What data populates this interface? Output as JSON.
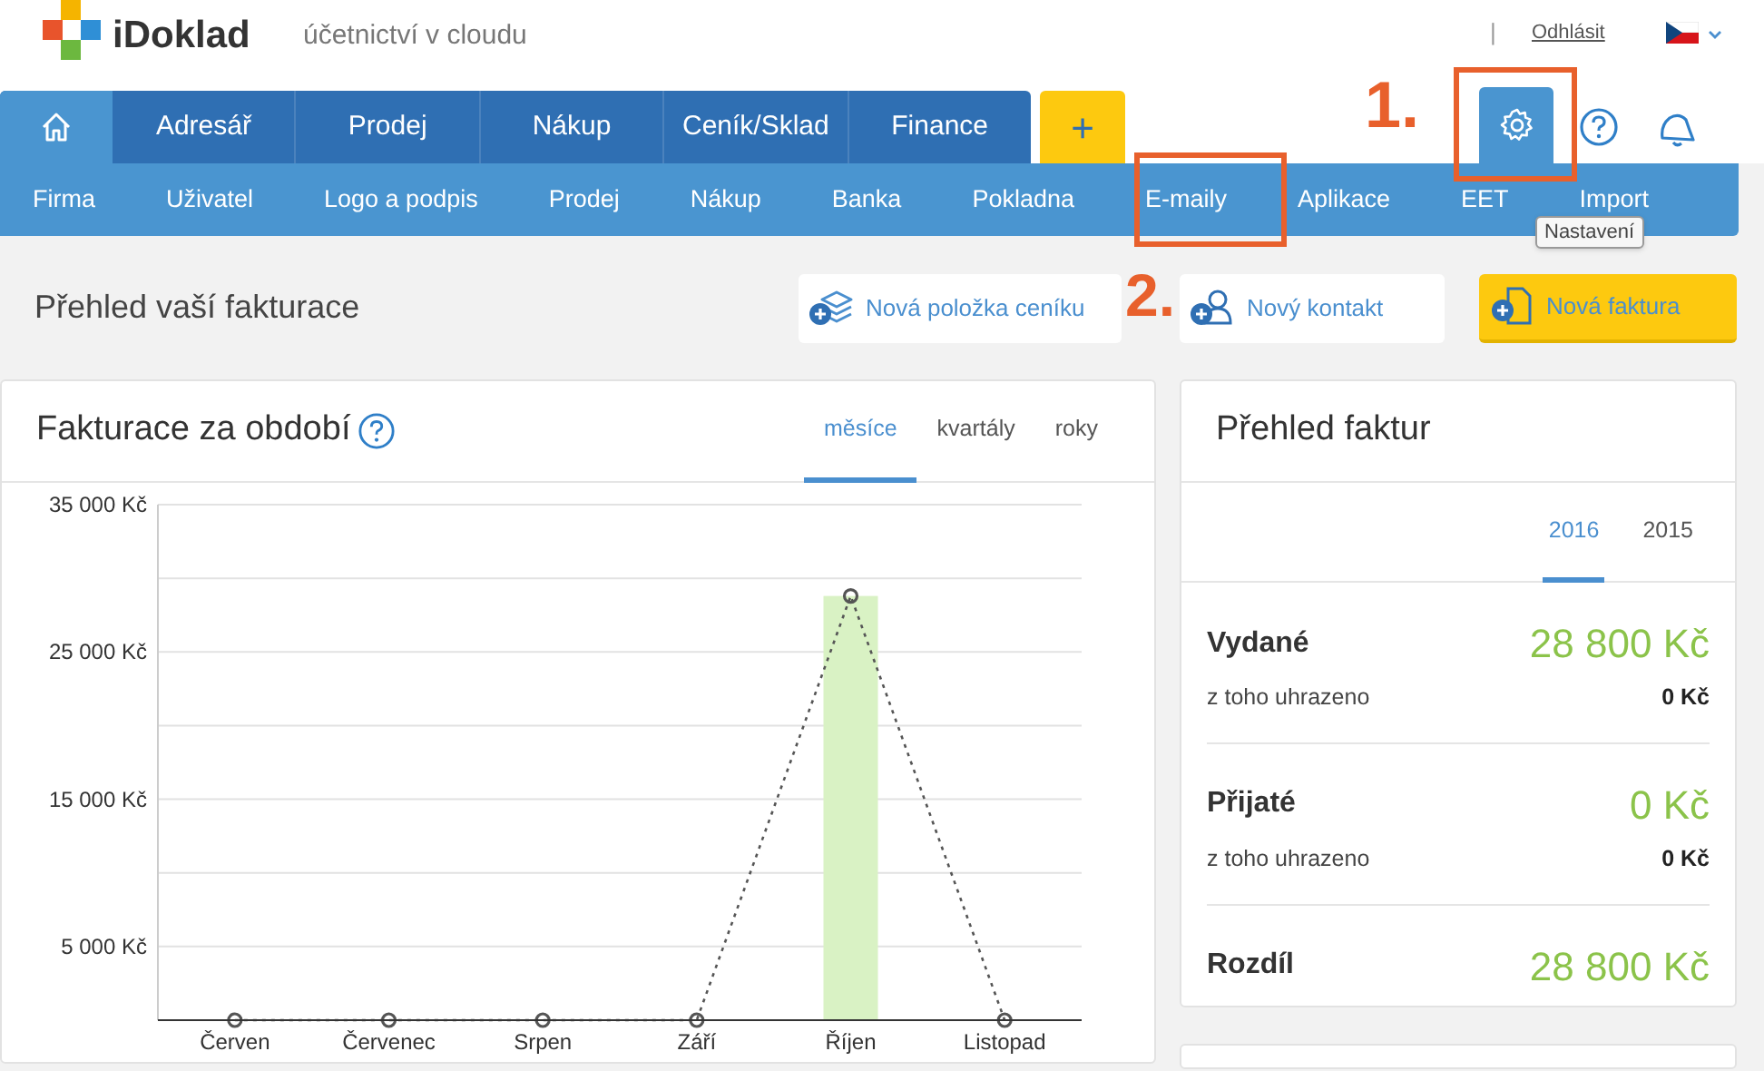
{
  "header": {
    "brand": "iDoklad",
    "tagline": "účetnictví v cloudu",
    "separator": "|",
    "logout": "Odhlásit"
  },
  "main_nav": [
    {
      "kind": "home",
      "selected": true
    },
    {
      "kind": "text",
      "label": "Adresář",
      "selected": false
    },
    {
      "kind": "text",
      "label": "Prodej",
      "selected": false
    },
    {
      "kind": "text",
      "label": "Nákup",
      "selected": false
    },
    {
      "kind": "text",
      "label": "Ceník/Sklad",
      "selected": false
    },
    {
      "kind": "text",
      "label": "Finance",
      "selected": false
    }
  ],
  "add_button": "+",
  "settings_selected": true,
  "settings_tooltip": "Nastavení",
  "sub_nav": [
    "Firma",
    "Uživatel",
    "Logo a podpis",
    "Prodej",
    "Nákup",
    "Banka",
    "Pokladna",
    "E-maily",
    "Aplikace",
    "EET",
    "Import"
  ],
  "annotations": [
    "1.",
    "2."
  ],
  "page_title": "Přehled vaší fakturace",
  "actions": [
    {
      "kind": "pricelist",
      "label": "Nová položka ceníku"
    },
    {
      "kind": "contact",
      "label": "Nový kontakt"
    },
    {
      "kind": "invoice",
      "label": "Nová faktura"
    }
  ],
  "billing_card": {
    "title": "Fakturace za období",
    "tabs": [
      {
        "label": "měsíce",
        "selected": true
      },
      {
        "label": "kvartály",
        "selected": false
      },
      {
        "label": "roky",
        "selected": false
      }
    ],
    "chart_data": {
      "type": "bar",
      "categories": [
        "Červen",
        "Červenec",
        "Srpen",
        "Září",
        "Říjen",
        "Listopad"
      ],
      "values": [
        0,
        0,
        0,
        0,
        28800,
        0
      ],
      "grid": true,
      "ylim": [
        0,
        35000
      ],
      "yticks": [
        {
          "value": 5000,
          "label": "5 000 Kč"
        },
        {
          "value": 15000,
          "label": "15 000 Kč"
        },
        {
          "value": 25000,
          "label": "25 000 Kč"
        },
        {
          "value": 35000,
          "label": "35 000 Kč"
        }
      ]
    }
  },
  "summary_card": {
    "title": "Přehled faktur",
    "tabs": [
      {
        "label": "2016",
        "selected": true
      },
      {
        "label": "2015",
        "selected": false
      }
    ],
    "rows": [
      {
        "label": "Vydané",
        "amount": "28 800 Kč",
        "sub_label": "z toho uhrazeno",
        "sub_amount": "0 Kč"
      },
      {
        "label": "Přijaté",
        "amount": "0 Kč",
        "sub_label": "z toho uhrazeno",
        "sub_amount": "0 Kč"
      },
      {
        "label": "Rozdíl",
        "amount": "28 800 Kč"
      }
    ]
  }
}
